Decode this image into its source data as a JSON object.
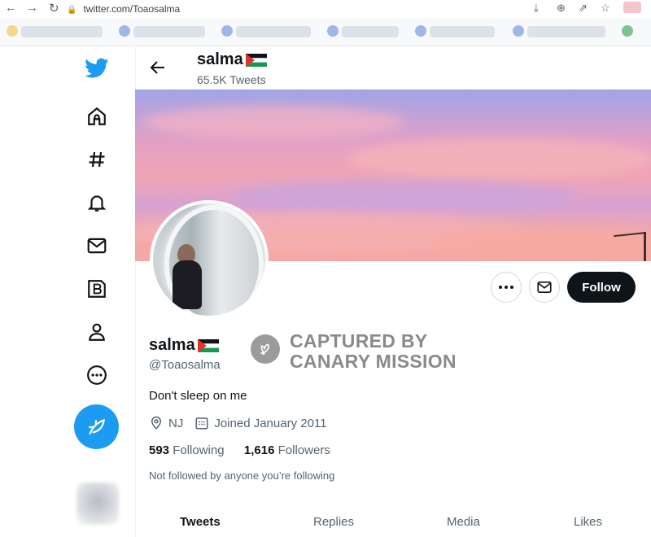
{
  "browser": {
    "url": "twitter.com/Toaosalma"
  },
  "header": {
    "name": "salma",
    "tweet_count": "65.5K Tweets"
  },
  "sidebar": {
    "items": [
      {
        "icon": "twitter-logo-icon"
      },
      {
        "icon": "home-icon"
      },
      {
        "icon": "explore-hashtag-icon"
      },
      {
        "icon": "notifications-bell-icon"
      },
      {
        "icon": "messages-envelope-icon"
      },
      {
        "icon": "twitter-blue-icon"
      },
      {
        "icon": "profile-person-icon"
      },
      {
        "icon": "more-circle-icon"
      },
      {
        "icon": "compose-tweet-icon"
      }
    ]
  },
  "profile": {
    "display_name": "salma",
    "handle": "@Toaosalma",
    "bio": "Don't sleep on me",
    "location": "NJ",
    "joined": "Joined January 2011",
    "following_count": "593",
    "following_label": "Following",
    "followers_count": "1,616",
    "followers_label": "Followers",
    "not_followed_text": "Not followed by anyone you’re following"
  },
  "actions": {
    "follow_label": "Follow"
  },
  "watermark": {
    "line1": "CAPTURED BY",
    "line2": "CANARY MISSION"
  },
  "tabs": [
    {
      "label": "Tweets",
      "active": true
    },
    {
      "label": "Replies"
    },
    {
      "label": "Media"
    },
    {
      "label": "Likes"
    }
  ],
  "colors": {
    "twitter_blue": "#1d9bf0",
    "follow_button": "#0f1419",
    "secondary_text": "#536471",
    "flag_red": "#e4312b",
    "flag_green": "#149954"
  }
}
